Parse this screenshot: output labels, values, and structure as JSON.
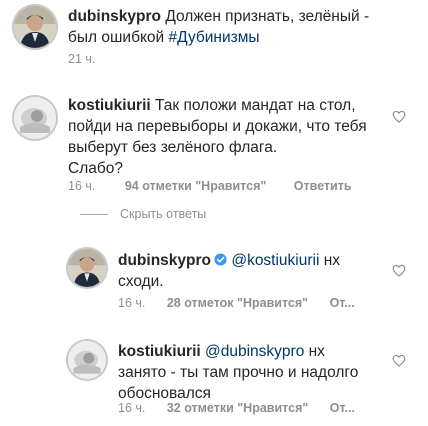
{
  "post": {
    "username": "dubinskypro",
    "caption_line1": "Должен признать, зелёный -",
    "caption_line2": "был ошибкой",
    "hashtag": "#Дубинизмы",
    "time": "21 ч."
  },
  "comment": {
    "username": "kostiukiurii",
    "line1": "Так положи мандат на стол,",
    "line2": "пойди на перевыборы и докажи, что тебя",
    "line3": "выберут без зелёного флага.",
    "line4": "Слабо?",
    "time": "16 ч.",
    "likes": "94 отметки \"Нравится\"",
    "reply": "Ответить",
    "icon": "heart-outline-icon"
  },
  "hide_replies": "Скрыть ответы",
  "replies": [
    {
      "username": "dubinskypro",
      "mention": "@kostiukiurii",
      "text_after_mention": " нх",
      "line2": "сходи.",
      "time": "16 ч.",
      "likes": "28 отметок \"Нравится\"",
      "reply": "От...",
      "verified_icon": "verified-badge-icon"
    },
    {
      "username": "kostiukiurii",
      "mention": "@dubinskypro",
      "text_after_mention": " нх",
      "line2": "занято - ты там прочно и надолго",
      "line3": "обосновался",
      "time": "16 ч.",
      "likes": "32 отметки \"Нравится\"",
      "reply": "От..."
    }
  ],
  "colors": {
    "text": "#262626",
    "muted": "#8e8e8e",
    "link": "#00376b",
    "verified": "#3897f0"
  }
}
